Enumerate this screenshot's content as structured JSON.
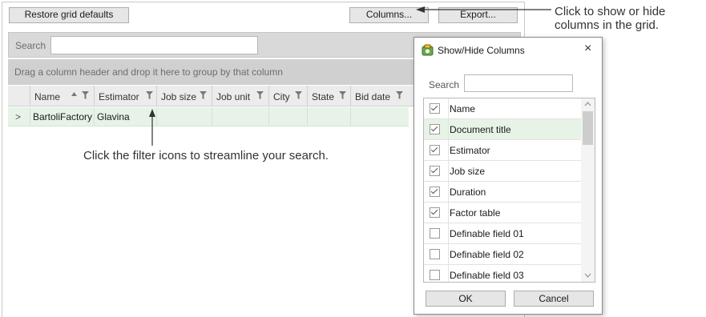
{
  "toolbar": {
    "restore_label": "Restore grid defaults",
    "columns_label": "Columns...",
    "export_label": "Export..."
  },
  "search": {
    "label": "Search"
  },
  "group_hint": "Drag a column header and drop it here to group by that column",
  "grid": {
    "columns": [
      "Name",
      "Estimator",
      "Job size",
      "Job unit",
      "City",
      "State",
      "Bid date"
    ],
    "rows": [
      {
        "expander": ">",
        "name": "BartoliFactory",
        "estimator": "Glavina"
      }
    ]
  },
  "callouts": {
    "columns_hint_line1": "Click to show or hide",
    "columns_hint_line2": "columns in the grid.",
    "filter_hint": "Click the filter icons to streamline your search."
  },
  "dialog": {
    "title": "Show/Hide Columns",
    "close": "×",
    "search_label": "Search",
    "items": [
      {
        "label": "Name",
        "checked": true
      },
      {
        "label": "Document title",
        "checked": true
      },
      {
        "label": "Estimator",
        "checked": true
      },
      {
        "label": "Job size",
        "checked": true
      },
      {
        "label": "Duration",
        "checked": true
      },
      {
        "label": "Factor table",
        "checked": true
      },
      {
        "label": "Definable field 01",
        "checked": false
      },
      {
        "label": "Definable field 02",
        "checked": false
      },
      {
        "label": "Definable field 03",
        "checked": false
      }
    ],
    "ok_label": "OK",
    "cancel_label": "Cancel"
  },
  "colors": {
    "selected_row": "#e6f3e6",
    "toolbar_button": "#e6e6e6",
    "group_bar": "#d0d0d0"
  }
}
